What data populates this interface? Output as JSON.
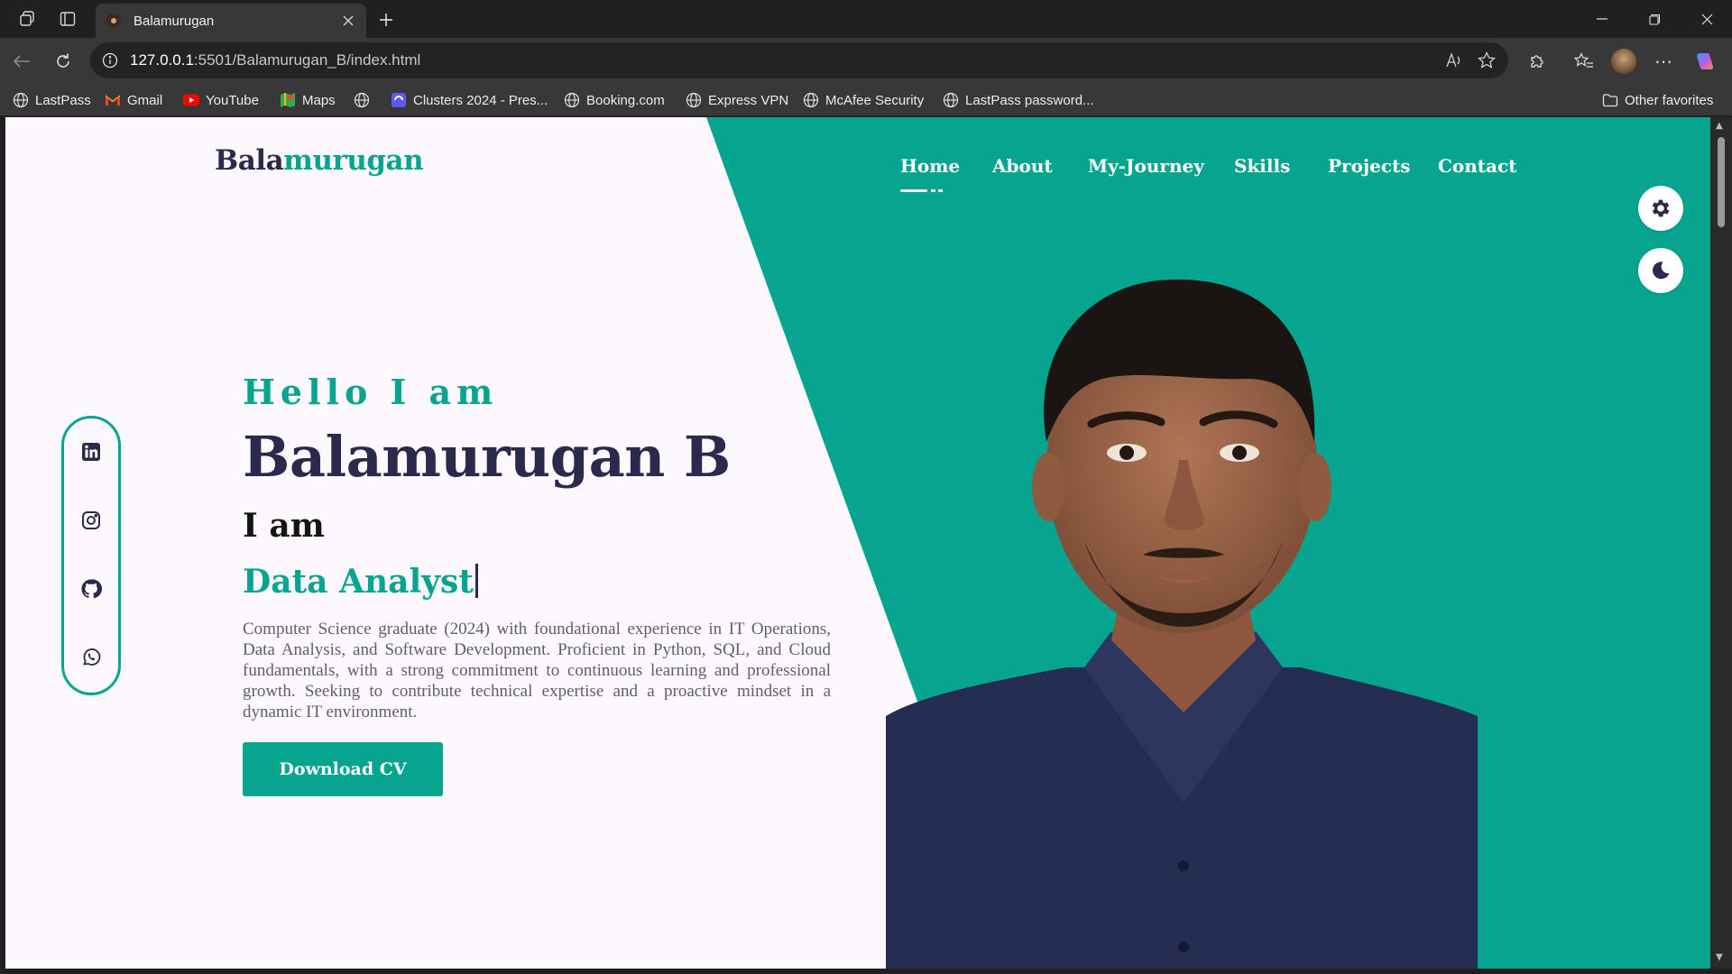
{
  "browser": {
    "tab_title": "Balamurugan",
    "url_host": "127.0.0.1",
    "url_path": ":5501/Balamurugan_B/index.html",
    "favorites": [
      {
        "label": "LastPass",
        "icon": "globe-icon"
      },
      {
        "label": "Gmail",
        "icon": "gmail-icon"
      },
      {
        "label": "YouTube",
        "icon": "youtube-icon"
      },
      {
        "label": "Maps",
        "icon": "maps-icon"
      },
      {
        "label": "",
        "icon": "globe-icon"
      },
      {
        "label": "Clusters 2024 - Pres...",
        "icon": "clusters-icon"
      },
      {
        "label": "Booking.com",
        "icon": "globe-icon"
      },
      {
        "label": "Express VPN",
        "icon": "globe-icon"
      },
      {
        "label": "McAfee Security",
        "icon": "globe-icon"
      },
      {
        "label": "LastPass password...",
        "icon": "globe-icon"
      }
    ],
    "other_favorites": "Other favorites"
  },
  "site": {
    "logo_part1": "Bala",
    "logo_part2": "murugan",
    "nav": [
      "Home",
      "About",
      "My-Journey",
      "Skills",
      "Projects",
      "Contact"
    ],
    "active_nav": "Home",
    "hero": {
      "greeting": "Hello I am",
      "name": "Balamurugan B",
      "iam": "I am",
      "role": "Data Analyst",
      "description": "Computer Science graduate (2024) with foundational experience in IT Operations, Data Analysis, and Software Development. Proficient in Python, SQL, and Cloud fundamentals, with a strong commitment to continuous learning and professional growth. Seeking to contribute technical expertise and a proactive mindset in a dynamic IT environment.",
      "cv_button": "Download CV"
    },
    "social_icons": [
      "linkedin-icon",
      "instagram-icon",
      "github-icon",
      "whatsapp-icon"
    ],
    "colors": {
      "accent": "#07a58f",
      "dark": "#2b2a4c",
      "page_bg": "#fdf8fd"
    }
  }
}
